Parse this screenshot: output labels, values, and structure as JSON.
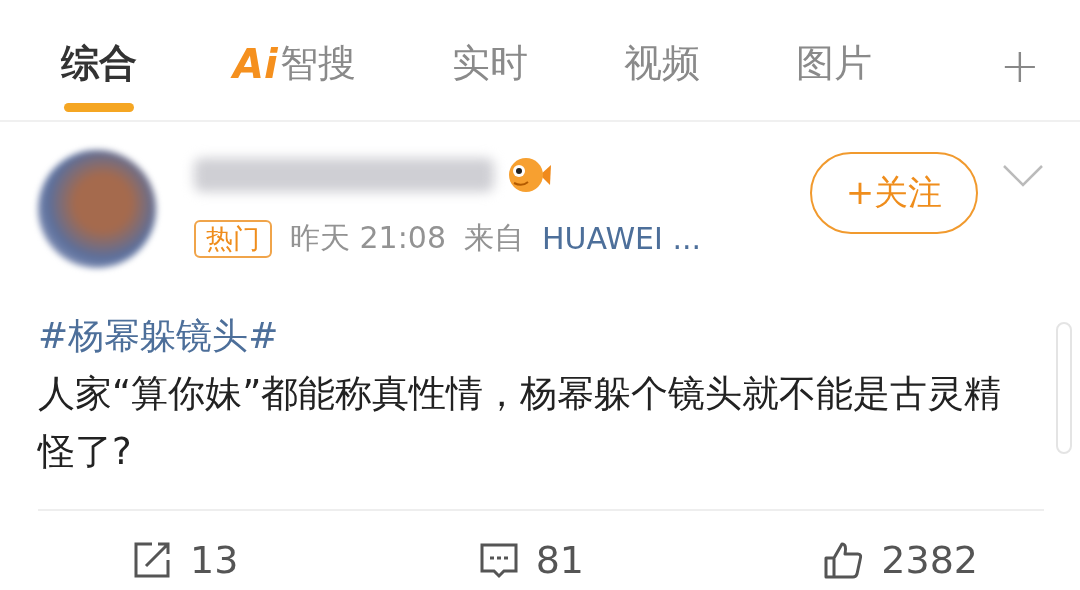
{
  "tabs": [
    {
      "kind": "plain",
      "label": "综合",
      "selected": true
    },
    {
      "kind": "ai",
      "badge": "Ai",
      "label": "智搜",
      "selected": false
    },
    {
      "kind": "plain",
      "label": "实时",
      "selected": false
    },
    {
      "kind": "plain",
      "label": "视频",
      "selected": false
    },
    {
      "kind": "plain",
      "label": "图片",
      "selected": false
    }
  ],
  "add_tab": "+",
  "post": {
    "tag": "热门",
    "time": "昨天 21:08",
    "source_prefix": "来自",
    "source": "HUAWEI ...",
    "follow_button": "+关注",
    "followed": false,
    "topic": "#杨幂躲镜头#",
    "text": "人家“算你妹”都能称真性情，杨幂躲个镜头就不能是古灵精怪了?",
    "actions": [
      {
        "kind": "repost",
        "count": "13"
      },
      {
        "kind": "comment",
        "count": "81"
      },
      {
        "kind": "like",
        "count": "2382"
      }
    ]
  }
}
